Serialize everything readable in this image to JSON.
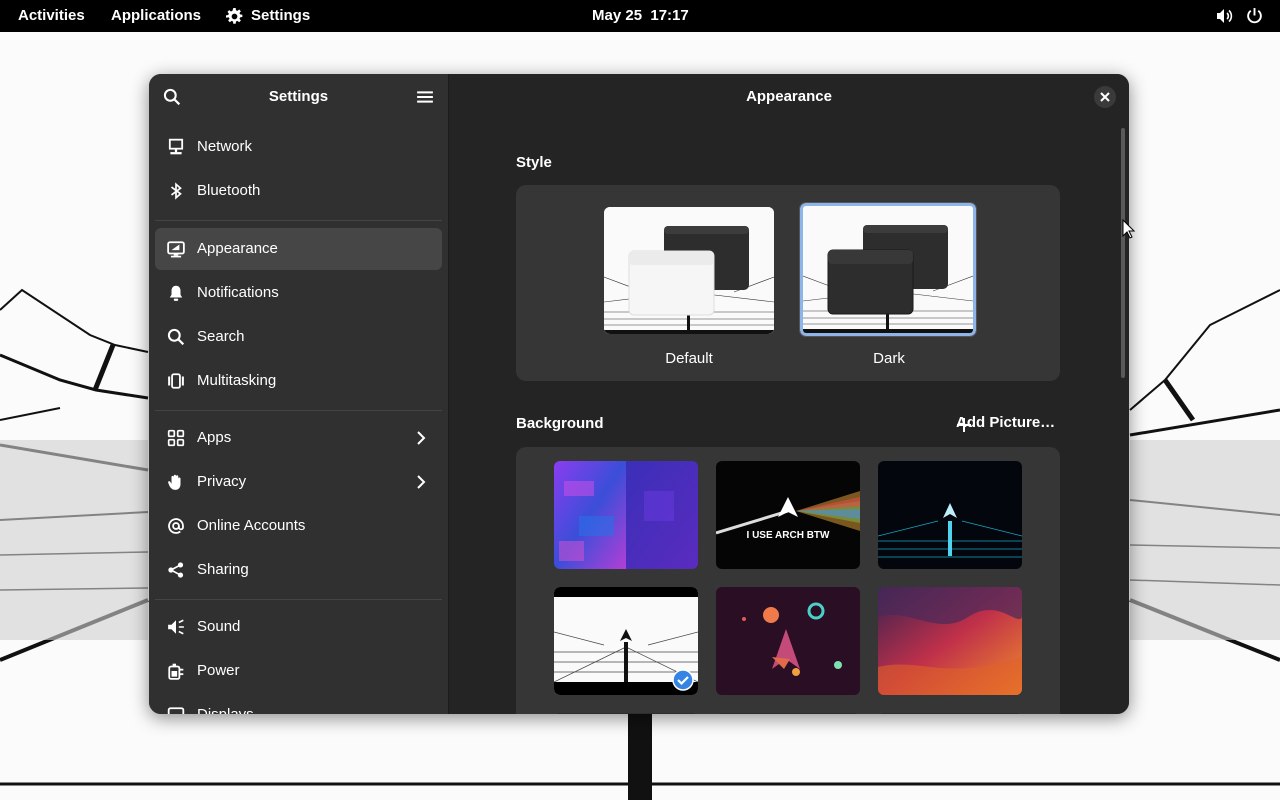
{
  "topbar": {
    "activities": "Activities",
    "applications": "Applications",
    "app_menu": "Settings",
    "clock": "May 25  17:17"
  },
  "sidebar": {
    "title": "Settings",
    "items": [
      {
        "label": "Network",
        "icon": "network-icon"
      },
      {
        "label": "Bluetooth",
        "icon": "bluetooth-icon"
      },
      {
        "label": "Appearance",
        "icon": "appearance-icon",
        "active": true
      },
      {
        "label": "Notifications",
        "icon": "bell-icon"
      },
      {
        "label": "Search",
        "icon": "search-icon"
      },
      {
        "label": "Multitasking",
        "icon": "multitasking-icon"
      },
      {
        "label": "Apps",
        "icon": "apps-icon",
        "submenu": true
      },
      {
        "label": "Privacy",
        "icon": "hand-icon",
        "submenu": true
      },
      {
        "label": "Online Accounts",
        "icon": "at-icon"
      },
      {
        "label": "Sharing",
        "icon": "share-icon"
      },
      {
        "label": "Sound",
        "icon": "speaker-icon"
      },
      {
        "label": "Power",
        "icon": "battery-icon"
      },
      {
        "label": "Displays",
        "icon": "display-icon"
      }
    ]
  },
  "content": {
    "title": "Appearance",
    "style": {
      "section_title": "Style",
      "options": [
        {
          "label": "Default",
          "selected": false
        },
        {
          "label": "Dark",
          "selected": true
        }
      ]
    },
    "background": {
      "section_title": "Background",
      "add_picture": "Add Picture…",
      "arch_text": "I USE ARCH BTW",
      "selected_index": 3
    }
  },
  "colors": {
    "accent": "#8db5ea",
    "selection_check": "#3584e4",
    "window_bg": "#242424",
    "sidebar_bg": "#303030"
  }
}
